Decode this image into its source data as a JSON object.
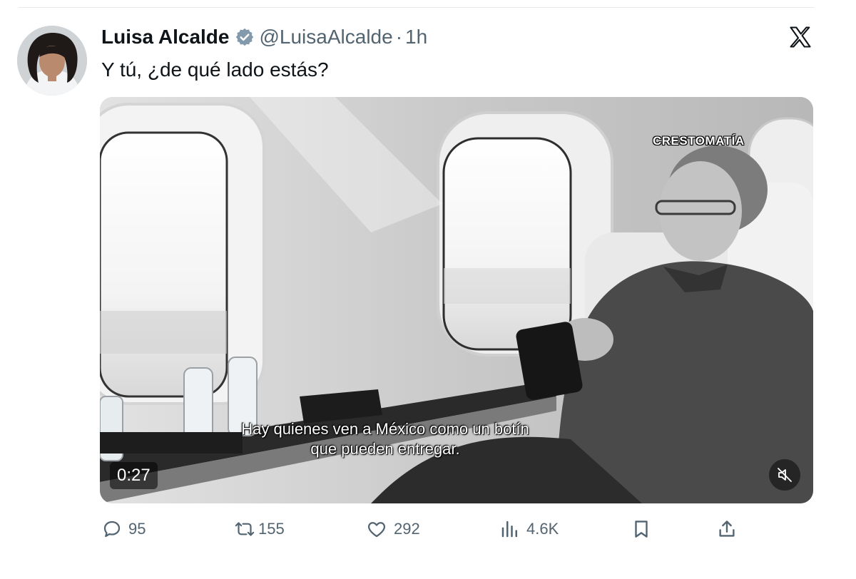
{
  "tweet": {
    "author": {
      "display_name": "Luisa Alcalde",
      "handle": "@LuisaAlcalde",
      "separator": "·",
      "timestamp": "1h",
      "verified": true
    },
    "text": "Y tú, ¿de qué lado estás?",
    "media": {
      "type": "video",
      "watermark": "CRESTOMATÍA",
      "subtitle_line_1": "Hay quienes ven a México como un botín",
      "subtitle_line_2": "que pueden entregar.",
      "duration": "0:27",
      "muted": true
    },
    "actions": {
      "replies": "95",
      "reposts": "155",
      "likes": "292",
      "views": "4.6K"
    }
  },
  "icons": {
    "platform": "x-logo",
    "verified": "verified-badge-icon",
    "reply": "reply-icon",
    "repost": "repost-icon",
    "like": "heart-icon",
    "views": "views-icon",
    "bookmark": "bookmark-icon",
    "share": "share-icon",
    "mute": "mute-icon"
  },
  "colors": {
    "text_primary": "#0f1419",
    "text_secondary": "#536471",
    "verified_badge": "#829aab"
  }
}
